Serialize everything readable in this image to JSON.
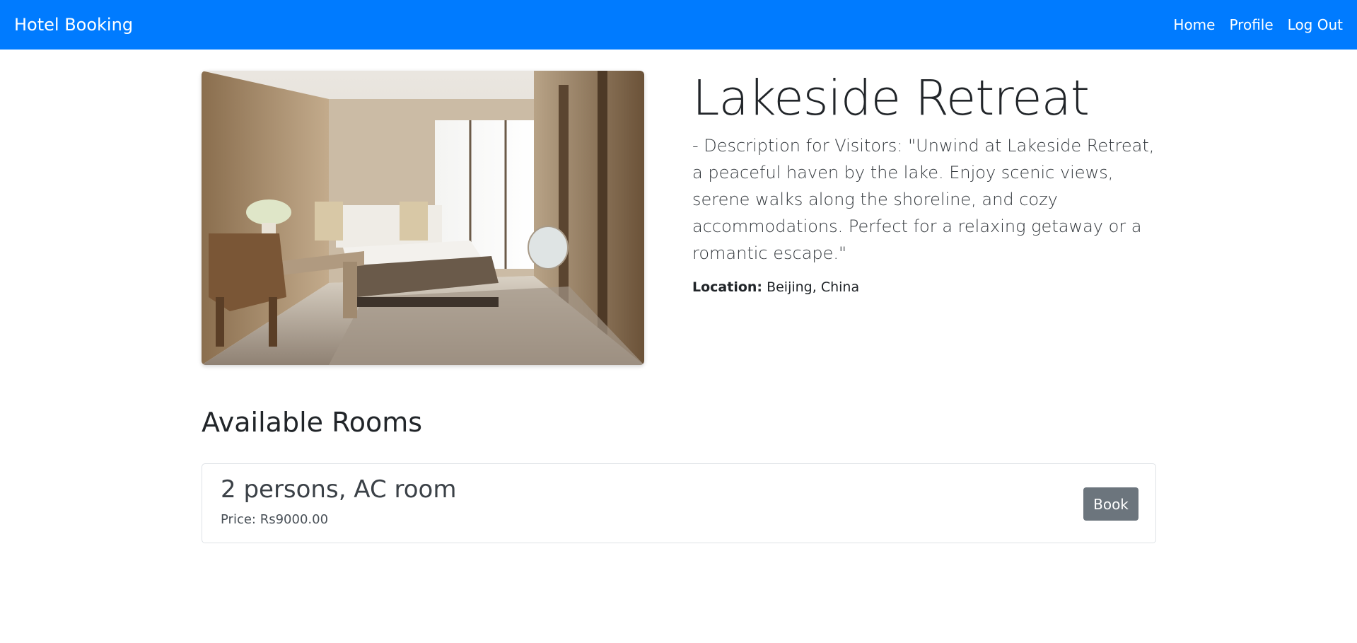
{
  "navbar": {
    "brand": "Hotel Booking",
    "links": [
      "Home",
      "Profile",
      "Log Out"
    ],
    "background": "#007bff"
  },
  "hotel": {
    "name": "Lakeside Retreat",
    "description": "- Description for Visitors: \"Unwind at Lakeside Retreat, a peaceful haven by the lake. Enjoy scenic views, serene walks along the shoreline, and cozy accommodations. Perfect for a relaxing getaway or a romantic escape.\"",
    "location_label": "Location:",
    "location_value": "Beijing, China",
    "image_icon": "hotel-room-photo"
  },
  "rooms_section": {
    "title": "Available Rooms",
    "rooms": [
      {
        "title": "2 persons, AC room",
        "price": "Price: Rs9000.00",
        "book_label": "Book"
      }
    ]
  }
}
